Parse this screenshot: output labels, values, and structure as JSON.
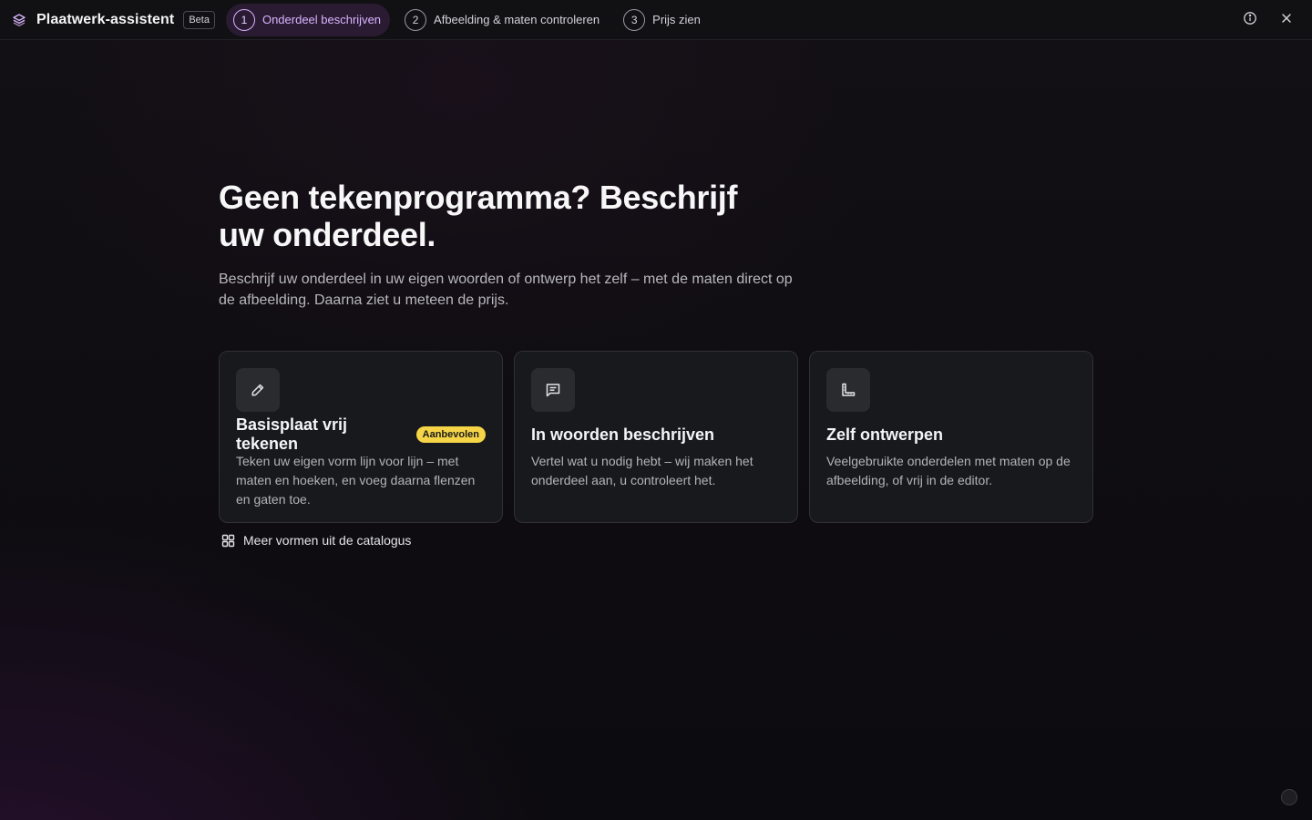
{
  "app": {
    "title": "Plaatwerk-assistent",
    "badge": "Beta",
    "brand_icon": "layers-icon",
    "accent": "#d8b4fe"
  },
  "steps": [
    {
      "num": "1",
      "label": "Onderdeel beschrijven",
      "active": true
    },
    {
      "num": "2",
      "label": "Afbeelding & maten controleren",
      "active": false
    },
    {
      "num": "3",
      "label": "Prijs zien",
      "active": false
    }
  ],
  "actions": {
    "info_icon": "info-icon",
    "close_icon": "close-icon"
  },
  "hero": {
    "title": "Geen tekenprogramma? Beschrijf uw onderdeel.",
    "subtitle": "Beschrijf uw onderdeel in uw eigen woorden of ontwerp het zelf – met de maten direct op de afbeelding. Daarna ziet u meteen de prijs."
  },
  "cards": [
    {
      "icon": "pencil-icon",
      "title": "Basisplaat vrij tekenen",
      "badge": "Aanbevolen",
      "description": "Teken uw eigen vorm lijn voor lijn – met maten en hoeken, en voeg daarna flenzen en gaten toe."
    },
    {
      "icon": "message-icon",
      "title": "In woorden beschrijven",
      "description": "Vertel wat u nodig hebt – wij maken het onderdeel aan, u controleert het."
    },
    {
      "icon": "ruler-icon",
      "title": "Zelf ontwerpen",
      "description": "Veelgebruikte onderdelen met maten op de afbeelding, of vrij in de editor."
    }
  ],
  "catalog": {
    "label": "Meer vormen uit de catalogus",
    "icon": "grid-icon"
  },
  "colors": {
    "badge_yellow": "#f5d547",
    "active_step_bg": "#2a1b33"
  }
}
